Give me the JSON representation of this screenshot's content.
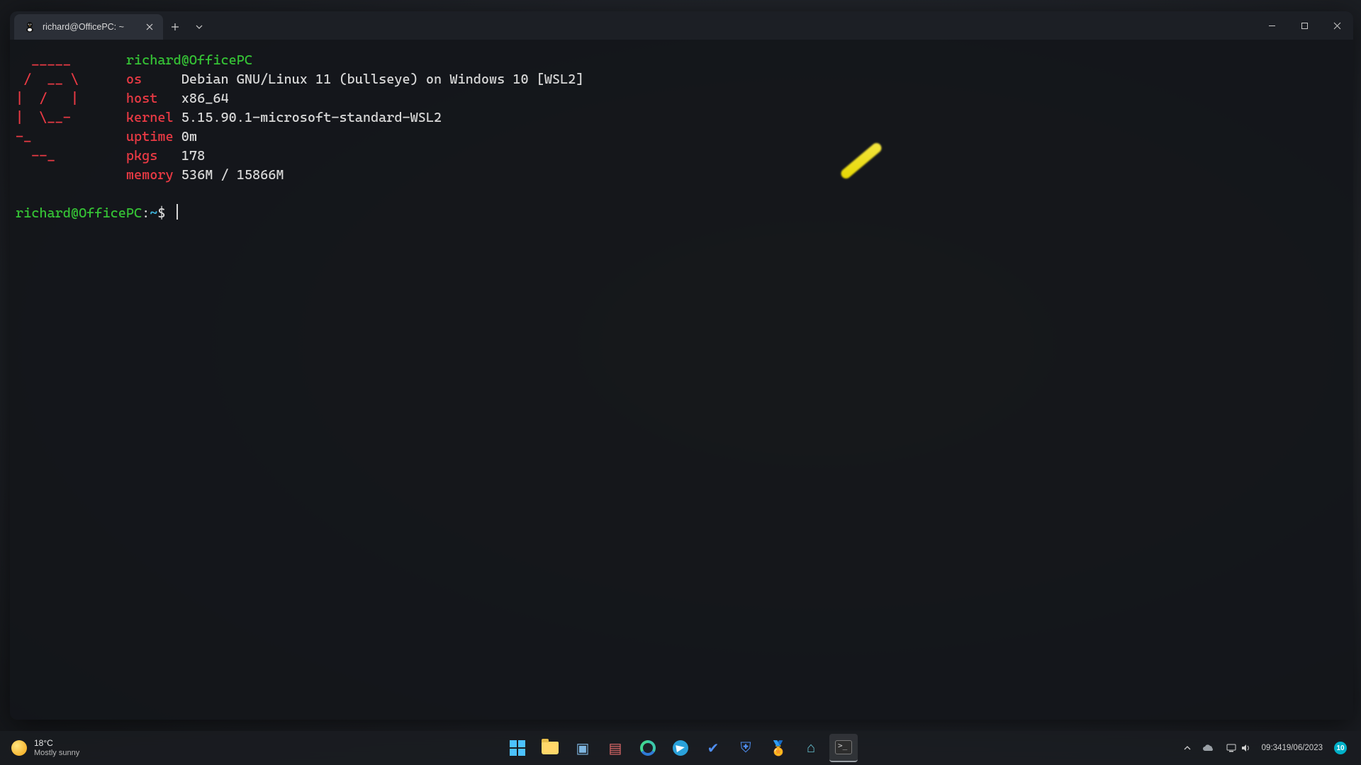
{
  "window": {
    "tab_title": "richard@OfficePC: ~",
    "tab_icon": "tux-icon"
  },
  "fetch": {
    "ascii": [
      "  _____   ",
      " /  __ \\  ",
      "|  /   |  ",
      "|  \\__-   ",
      "-_        ",
      "  --_     "
    ],
    "header": "richard@OfficePC",
    "rows": [
      {
        "label": "os",
        "value": "Debian GNU/Linux 11 (bullseye) on Windows 10 [WSL2]"
      },
      {
        "label": "host",
        "value": "x86_64"
      },
      {
        "label": "kernel",
        "value": "5.15.90.1-microsoft-standard-WSL2"
      },
      {
        "label": "uptime",
        "value": "0m"
      },
      {
        "label": "pkgs",
        "value": "178"
      },
      {
        "label": "memory",
        "value": "536M / 15866M"
      }
    ]
  },
  "prompt": {
    "userhost": "richard@OfficePC",
    "sep": ":",
    "path": "~",
    "sigil": "$"
  },
  "taskbar": {
    "weather_temp": "18°C",
    "weather_desc": "Mostly sunny",
    "clock_time": "09:34",
    "clock_date": "19/06/2023",
    "notif_count": "10",
    "apps": [
      "start",
      "explorer",
      "store",
      "news",
      "edge",
      "telegram",
      "todo",
      "security",
      "rewards",
      "devhome",
      "terminal"
    ]
  }
}
